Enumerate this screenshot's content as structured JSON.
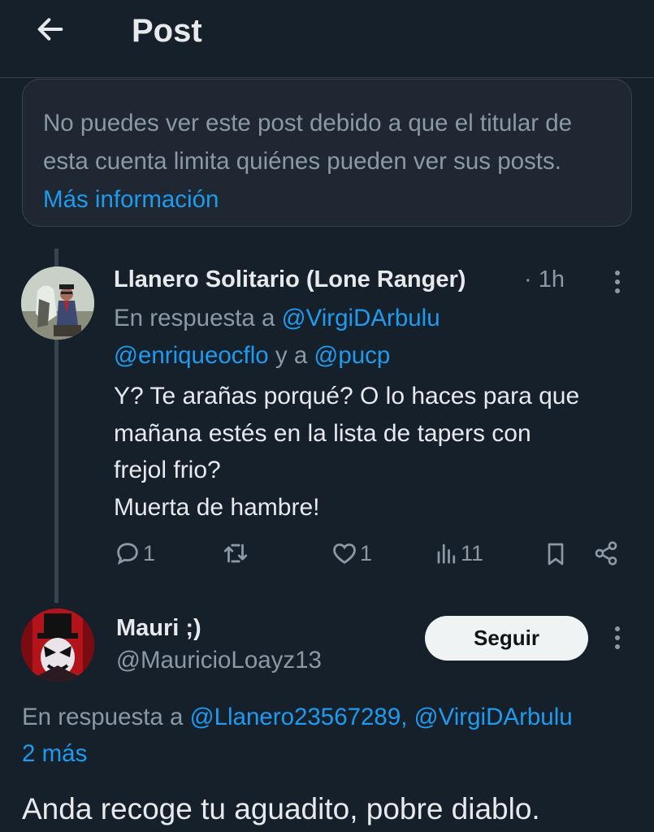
{
  "header": {
    "title": "Post",
    "back_icon": "arrow-left-icon"
  },
  "notice": {
    "text": "No puedes ver este post debido a que el titular de esta cuenta limita quiénes pueden ver sus posts.",
    "link": "Más información"
  },
  "reply1": {
    "name": "Llanero Solitario (Lone Ranger)",
    "time": "· 1h",
    "reply_prefix": "En respuesta a ",
    "mention1": "@VirgiDArbulu",
    "mention2": "@enriqueocflo",
    "reply_joiner": " y a ",
    "mention3": "@pucp",
    "body_lines": [
      "Y? Te arañas porqué? O lo haces para que",
      "mañana estés en la lista de tapers con",
      "frejol frio?",
      "Muerta de hambre!"
    ],
    "actions": {
      "replies": "1",
      "retweets": "",
      "likes": "1",
      "views": "11"
    }
  },
  "reply2": {
    "name": "Mauri ;)",
    "handle": "@MauricioLoayz13",
    "follow_label": "Seguir",
    "reply_prefix": "En respuesta a ",
    "mention1": "@Llanero23567289,",
    "mention2": "@VirgiDArbulu",
    "more_link": "2 más",
    "body": "Anda recoge tu aguadito, pobre diablo."
  },
  "colors": {
    "background": "#15202b",
    "accent": "#1d9bf0",
    "muted": "#8b98a5",
    "text": "#e7e9ea",
    "border": "#38444d"
  }
}
